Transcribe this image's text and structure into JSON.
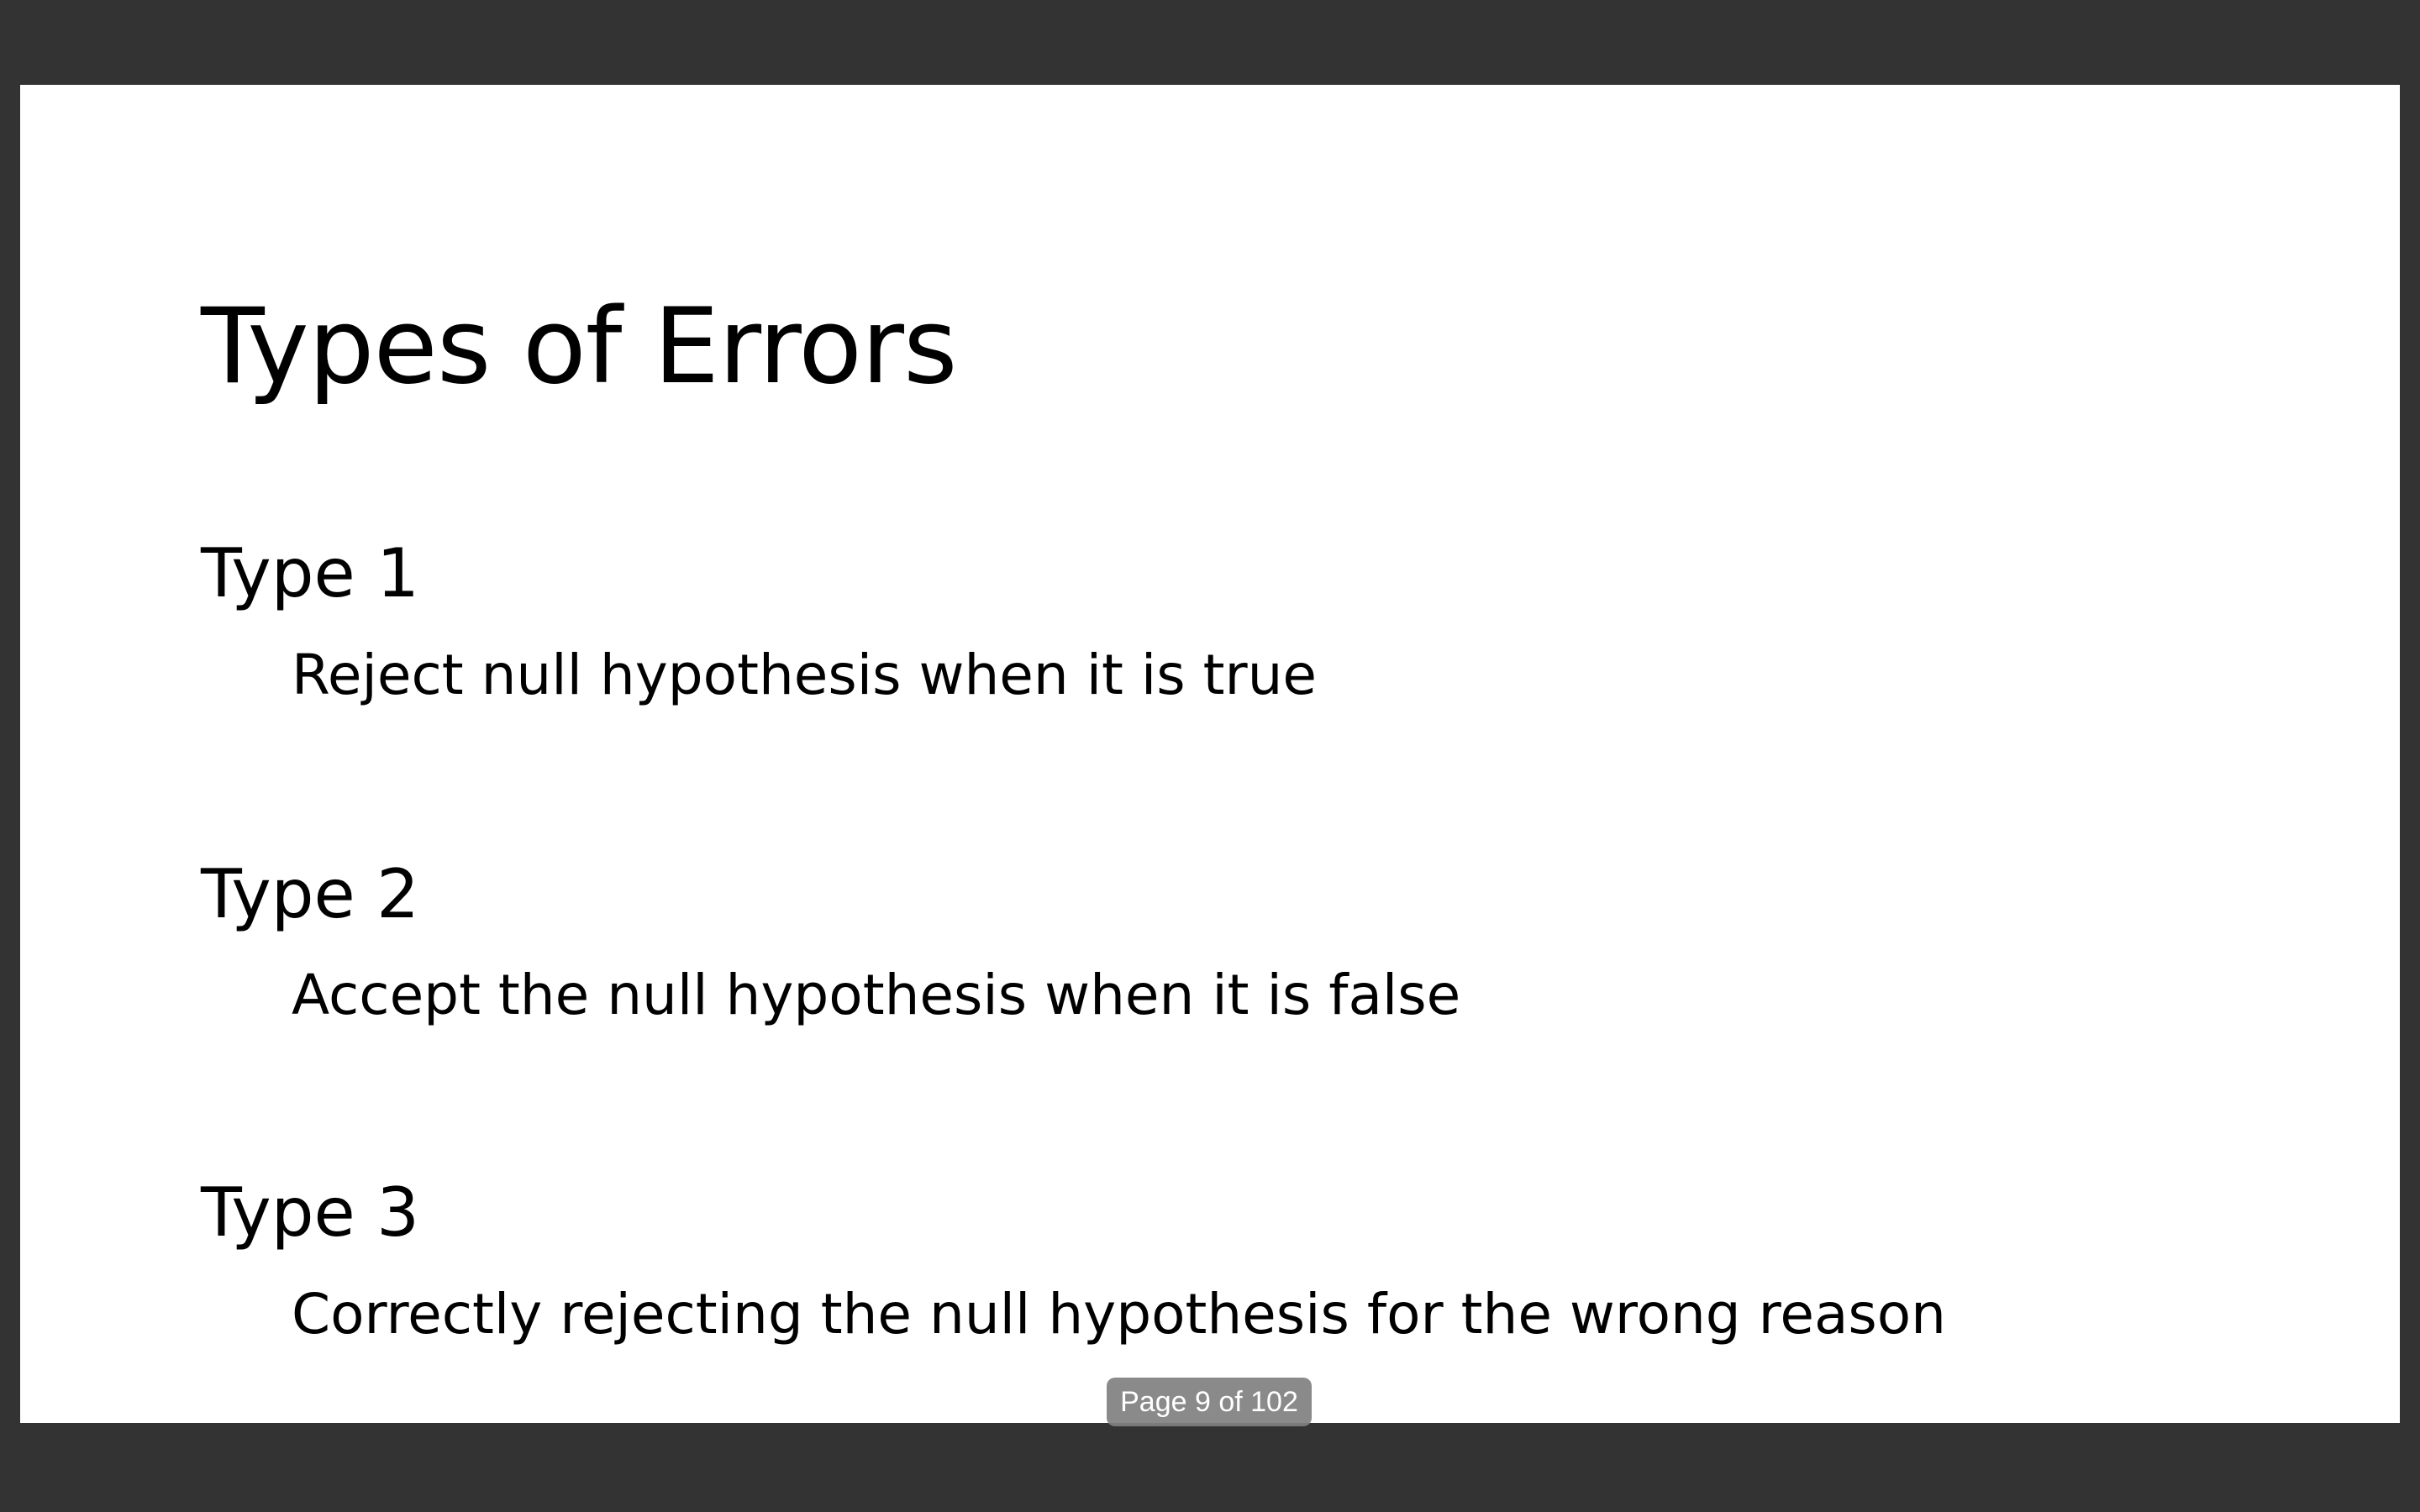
{
  "slide": {
    "title": "Types of Errors",
    "sections": [
      {
        "heading": "Type 1",
        "description": "Reject null hypothesis when it is true"
      },
      {
        "heading": "Type 2",
        "description": "Accept the null hypothesis when it is false"
      },
      {
        "heading": "Type 3",
        "description": "Correctly rejecting the null hypothesis for the wrong reason"
      }
    ]
  },
  "page_indicator": {
    "label": "Page 9 of 102"
  },
  "colors": {
    "background": "#333333",
    "slide": "#ffffff",
    "text": "#000000",
    "indicator": "#808080"
  }
}
